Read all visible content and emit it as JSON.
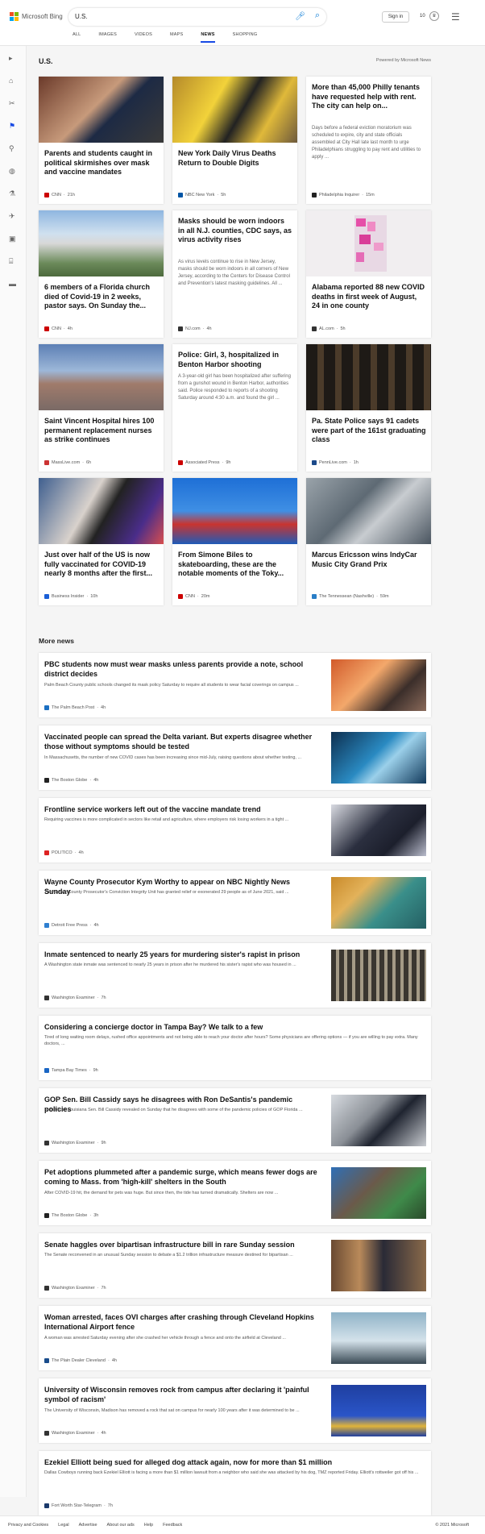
{
  "header": {
    "brand": "Microsoft Bing",
    "query": "U.S.",
    "tabs": [
      "ALL",
      "IMAGES",
      "VIDEOS",
      "MAPS",
      "NEWS",
      "SHOPPING"
    ],
    "active_tab": "NEWS",
    "signin_label": "Sign in",
    "rewards_count": "10",
    "colors": {
      "accent": "#174ae4",
      "ms_red": "#f25022",
      "ms_green": "#7fba00",
      "ms_blue": "#00a4ef",
      "ms_yellow": "#ffb900"
    }
  },
  "sidebar": {
    "icons": [
      "expand-icon",
      "home-icon",
      "sports-icon",
      "politics-icon",
      "local-icon",
      "world-icon",
      "science-icon",
      "technology-icon",
      "entertainment-icon",
      "business-icon",
      "money-icon"
    ]
  },
  "section": {
    "title": "U.S.",
    "powered_by": "Powered by Microsoft News"
  },
  "cards": [
    {
      "title": "Parents and students caught in political skirmishes over mask and vaccine mandates",
      "source": "CNN",
      "age": "21h",
      "color": "#c00"
    },
    {
      "title": "New York Daily Virus Deaths Return to Double Digits",
      "source": "NBC New York",
      "age": "5h",
      "color": "#0055a5"
    },
    {
      "title": "More than 45,000 Philly tenants have requested help with rent. The city can help on...",
      "snippet": "Days before a federal eviction moratorium was scheduled to expire, city and state officials assembled at City Hall late last month to urge Philadelphians struggling to pay rent and utilities to apply ...",
      "source": "Philadelphia Inquirer",
      "age": "15m",
      "color": "#222"
    },
    {
      "title": "6 members of a Florida church died of Covid-19 in 2 weeks, pastor says. On Sunday the...",
      "source": "CNN",
      "age": "4h",
      "color": "#c00"
    },
    {
      "title": "Masks should be worn indoors in all N.J. counties, CDC says, as virus activity rises",
      "snippet": "As virus levels continue to rise in New Jersey, masks should be worn indoors in all corners of New Jersey, according to the Centers for Disease Control and Prevention's latest masking guidelines. All ...",
      "source": "NJ.com",
      "age": "4h",
      "color": "#333"
    },
    {
      "title": "Alabama reported 88 new COVID deaths in first week of August, 24 in one county",
      "source": "AL.com",
      "age": "5h",
      "color": "#333"
    },
    {
      "title": "Saint Vincent Hospital hires 100 permanent replacement nurses as strike continues",
      "source": "MassLive.com",
      "age": "6h",
      "color": "#c33"
    },
    {
      "title": "Police: Girl, 3, hospitalized in Benton Harbor shooting",
      "snippet": "A 3-year-old girl has been hospitalized after suffering from a gunshot wound in Benton Harbor, authorities said. Police responded to reports of a shooting Saturday around 4:30 a.m. and found the girl ...",
      "source": "Associated Press",
      "age": "9h",
      "color": "#c00"
    },
    {
      "title": "Pa. State Police says 91 cadets were part of the 161st graduating class",
      "source": "PennLive.com",
      "age": "1h",
      "color": "#1c4a8a"
    },
    {
      "title": "Just over half of the US is now fully vaccinated for COVID-19 nearly 8 months after the first...",
      "source": "Business Insider",
      "age": "10h",
      "color": "#1a5fd6"
    },
    {
      "title": "From Simone Biles to skateboarding, these are the notable moments of the Toky...",
      "source": "CNN",
      "age": "20m",
      "color": "#c00"
    },
    {
      "title": "Marcus Ericsson wins IndyCar Music City Grand Prix",
      "source": "The Tennessean (Nashville)",
      "age": "59m",
      "color": "#2a7ec7"
    }
  ],
  "more_news": {
    "title": "More news",
    "items": [
      {
        "title": "PBC students now must wear masks unless parents provide a note, school district decides",
        "snippet": "Palm Beach County public schools changed its mask policy Saturday to require all students to wear facial coverings on campus ...",
        "source": "The Palm Beach Post",
        "age": "4h",
        "color": "#1b6fc2"
      },
      {
        "title": "Vaccinated people can spread the Delta variant. But experts disagree whether those without symptoms should be tested",
        "snippet": "In Massachusetts, the number of new COVID cases has been increasing since mid-July, raising questions about whether testing, ...",
        "source": "The Boston Globe",
        "age": "4h",
        "color": "#222"
      },
      {
        "title": "Frontline service workers left out of the vaccine mandate trend",
        "snippet": "Requiring vaccines is more complicated in sectors like retail and agriculture, where employers risk losing workers in a tight ...",
        "source": "POLITICO",
        "age": "4h",
        "color": "#d22"
      },
      {
        "title": "Wayne County Prosecutor Kym Worthy to appear on NBC Nightly News Sunday",
        "snippet": "The Wayne County Prosecutor's Conviction Integrity Unit has granted relief or exonerated 29 people as of June 2021, said ...",
        "source": "Detroit Free Press",
        "age": "4h",
        "color": "#2f7fd0"
      },
      {
        "title": "Inmate sentenced to nearly 25 years for murdering sister's rapist in prison",
        "snippet": "A Washington state inmate was sentenced to nearly 25 years in prison after he murdered his sister's rapist who was housed in ...",
        "source": "Washington Examiner",
        "age": "7h",
        "color": "#333"
      },
      {
        "title": "Considering a concierge doctor in Tampa Bay? We talk to a few",
        "snippet": "Tired of long waiting room delays, rushed office appointments and not being able to reach your doctor after hours? Some physicians are offering options — if you are willing to pay extra. Many doctors, ...",
        "source": "Tampa Bay Times",
        "age": "9h",
        "color": "#1a66c4",
        "wide": true
      },
      {
        "title": "GOP Sen. Bill Cassidy says he disagrees with Ron DeSantis's pandemic policies",
        "snippet": "Republican Louisiana Sen. Bill Cassidy revealed on Sunday that he disagrees with some of the pandemic policies of GOP Florida ...",
        "source": "Washington Examiner",
        "age": "9h",
        "color": "#333"
      },
      {
        "title": "Pet adoptions plummeted after a pandemic surge, which means fewer dogs are coming to Mass. from 'high-kill' shelters in the South",
        "snippet": "After COVID-19 hit, the demand for pets was huge. But since then, the tide has turned dramatically. Shelters are now ...",
        "source": "The Boston Globe",
        "age": "3h",
        "color": "#222"
      },
      {
        "title": "Senate haggles over bipartisan infrastructure bill in rare Sunday session",
        "snippet": "The Senate reconvened in an unusual Sunday session to debate a $1.2 trillion infrastructure measure destined for bipartisan ...",
        "source": "Washington Examiner",
        "age": "7h",
        "color": "#333"
      },
      {
        "title": "Woman arrested, faces OVI charges after crashing through Cleveland Hopkins International Airport fence",
        "snippet": "A woman was arrested Saturday evening after she crashed her vehicle through a fence and onto the airfield at Cleveland ...",
        "source": "The Plain Dealer Cleveland",
        "age": "4h",
        "color": "#1a4d8c"
      },
      {
        "title": "University of Wisconsin removes rock from campus after declaring it 'painful symbol of racism'",
        "snippet": "The University of Wisconsin, Madison has removed a rock that sat on campus for nearly 100 years after it was determined to be ...",
        "source": "Washington Examiner",
        "age": "4h",
        "color": "#333"
      },
      {
        "title": "Ezekiel Elliott being sued for alleged dog attack again, now for more than $1 million",
        "snippet": "Dallas Cowboys running back Ezekiel Elliott is facing a more than $1 million lawsuit from a neighbor who said she was attacked by his dog, TMZ reported Friday. Elliott's rottweiler got off his ...",
        "source": "Fort Worth Star-Telegram",
        "age": "7h",
        "color": "#1b3a6b",
        "wide": true
      }
    ]
  },
  "footer": {
    "links": [
      "Privacy and Cookies",
      "Legal",
      "Advertise",
      "About our ads",
      "Help",
      "Feedback"
    ],
    "copyright": "© 2021 Microsoft"
  }
}
